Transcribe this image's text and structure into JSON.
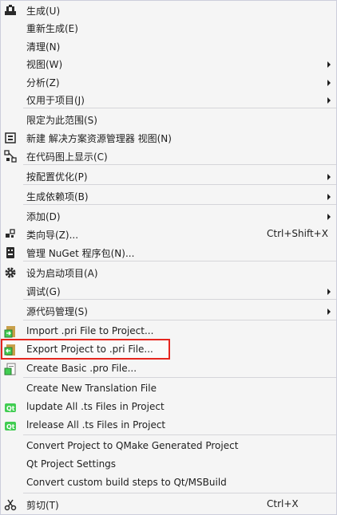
{
  "menu": {
    "items": [
      {
        "label": "生成(U)",
        "icon": "build-icon",
        "shortcut": "",
        "submenu": false
      },
      {
        "label": "重新生成(E)",
        "icon": "",
        "shortcut": "",
        "submenu": false
      },
      {
        "label": "清理(N)",
        "icon": "",
        "shortcut": "",
        "submenu": false
      },
      {
        "label": "视图(W)",
        "icon": "",
        "shortcut": "",
        "submenu": true
      },
      {
        "label": "分析(Z)",
        "icon": "",
        "shortcut": "",
        "submenu": true
      },
      {
        "label": "仅用于项目(J)",
        "icon": "",
        "shortcut": "",
        "submenu": true
      },
      {
        "label": "限定为此范围(S)",
        "icon": "",
        "shortcut": "",
        "submenu": false
      },
      {
        "label": "新建 解决方案资源管理器 视图(N)",
        "icon": "new-view-icon",
        "shortcut": "",
        "submenu": false
      },
      {
        "label": "在代码图上显示(C)",
        "icon": "code-map-icon",
        "shortcut": "",
        "submenu": false
      },
      {
        "label": "按配置优化(P)",
        "icon": "",
        "shortcut": "",
        "submenu": true
      },
      {
        "label": "生成依赖项(B)",
        "icon": "",
        "shortcut": "",
        "submenu": true
      },
      {
        "label": "添加(D)",
        "icon": "",
        "shortcut": "",
        "submenu": true
      },
      {
        "label": "类向导(Z)...",
        "icon": "class-wizard-icon",
        "shortcut": "Ctrl+Shift+X",
        "submenu": false
      },
      {
        "label": "管理 NuGet 程序包(N)...",
        "icon": "nuget-icon",
        "shortcut": "",
        "submenu": false
      },
      {
        "label": "设为启动项目(A)",
        "icon": "gear-icon",
        "shortcut": "",
        "submenu": false
      },
      {
        "label": "调试(G)",
        "icon": "",
        "shortcut": "",
        "submenu": true
      },
      {
        "label": "源代码管理(S)",
        "icon": "",
        "shortcut": "",
        "submenu": true
      },
      {
        "label": "Import .pri File to Project...",
        "icon": "import-pri-icon",
        "shortcut": "",
        "submenu": false
      },
      {
        "label": "Export Project to .pri File...",
        "icon": "export-pri-icon",
        "shortcut": "",
        "submenu": false
      },
      {
        "label": "Create Basic .pro File...",
        "icon": "create-pro-icon",
        "shortcut": "",
        "submenu": false
      },
      {
        "label": "Create New Translation File",
        "icon": "",
        "shortcut": "",
        "submenu": false
      },
      {
        "label": "lupdate All .ts Files in Project",
        "icon": "qt-icon",
        "shortcut": "",
        "submenu": false
      },
      {
        "label": "lrelease All .ts Files in Project",
        "icon": "qt-icon",
        "shortcut": "",
        "submenu": false
      },
      {
        "label": "Convert Project to QMake Generated Project",
        "icon": "",
        "shortcut": "",
        "submenu": false
      },
      {
        "label": "Qt Project Settings",
        "icon": "",
        "shortcut": "",
        "submenu": false
      },
      {
        "label": "Convert custom build steps to Qt/MSBuild",
        "icon": "",
        "shortcut": "",
        "submenu": false
      },
      {
        "label": "剪切(T)",
        "icon": "scissors-icon",
        "shortcut": "Ctrl+X",
        "submenu": false
      }
    ],
    "highlighted_index": 18,
    "colors": {
      "background": "#f5f5f5",
      "highlight_border": "#e5261f",
      "qt_green": "#41cd52"
    }
  }
}
